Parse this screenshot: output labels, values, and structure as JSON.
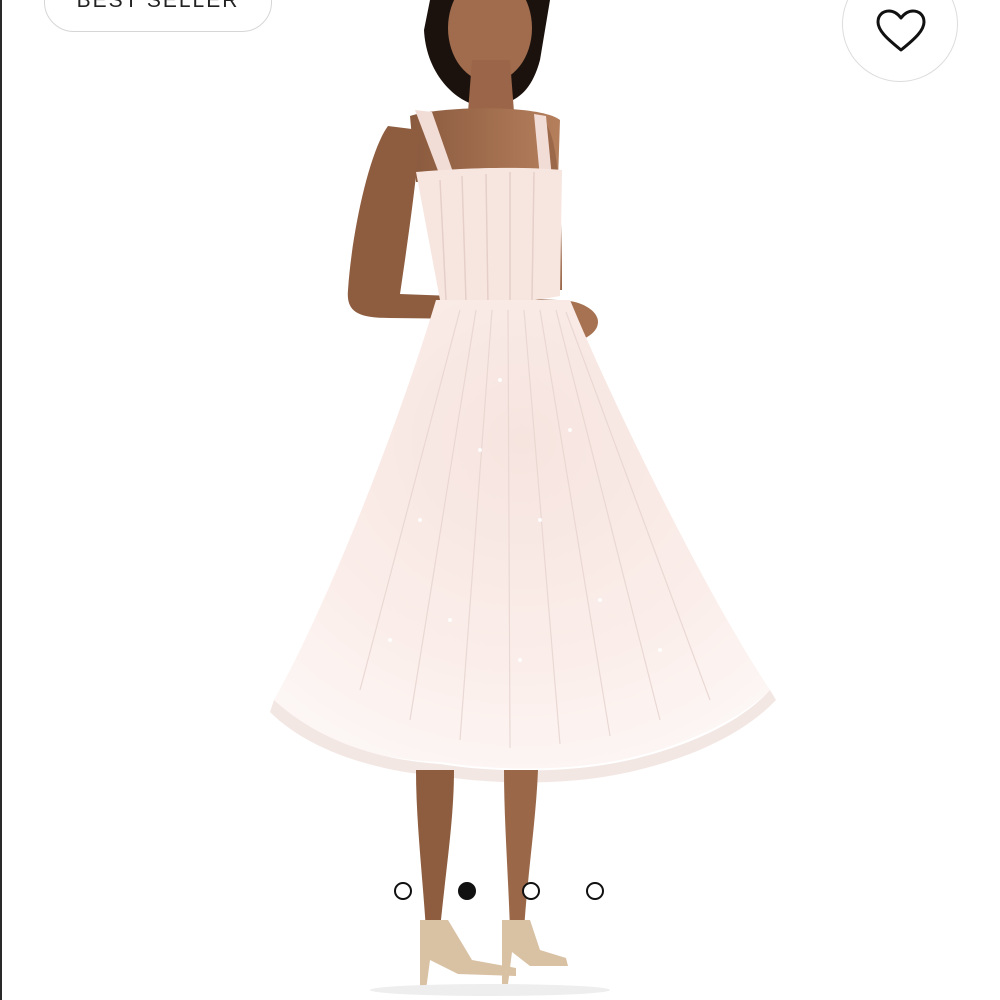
{
  "badge": {
    "label": "BEST SELLER"
  },
  "favorite": {
    "icon": "heart-outline-icon"
  },
  "carousel": {
    "dot_count": 4,
    "active_index": 1
  },
  "colors": {
    "background": "#ffffff",
    "dot_active": "#111111",
    "dress": "#fbeee8"
  }
}
